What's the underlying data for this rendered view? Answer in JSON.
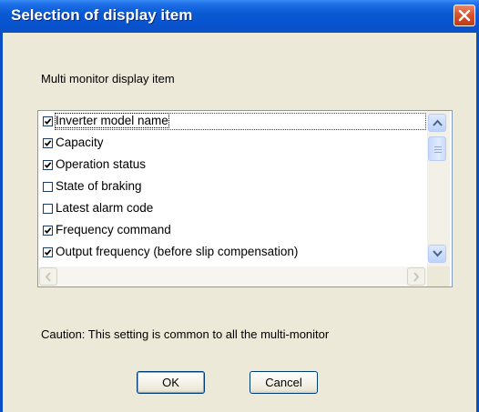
{
  "window": {
    "title": "Selection of display item"
  },
  "dialog": {
    "heading": "Multi monitor display item",
    "items": [
      {
        "label": "Inverter model name",
        "checked": true,
        "focused": true
      },
      {
        "label": "Capacity",
        "checked": true
      },
      {
        "label": "Operation status",
        "checked": true
      },
      {
        "label": "State of braking",
        "checked": false
      },
      {
        "label": "Latest alarm code",
        "checked": false
      },
      {
        "label": "Frequency command",
        "checked": true
      },
      {
        "label": "Output frequency (before slip compensation)",
        "checked": true
      }
    ],
    "caution": "Caution: This setting is common to all the multi-monitor",
    "ok_label": "OK",
    "cancel_label": "Cancel"
  },
  "icons": {
    "close": "close-icon",
    "scroll_up": "arrow-up-icon",
    "scroll_down": "arrow-down-icon",
    "scroll_left": "arrow-left-icon",
    "scroll_right": "arrow-right-icon",
    "checkbox": "checkmark-icon"
  },
  "colors": {
    "titlebar": "#0a5ad4",
    "close_button": "#d9532e",
    "dialog_bg": "#ece9d8",
    "list_border": "#7f9db9"
  }
}
